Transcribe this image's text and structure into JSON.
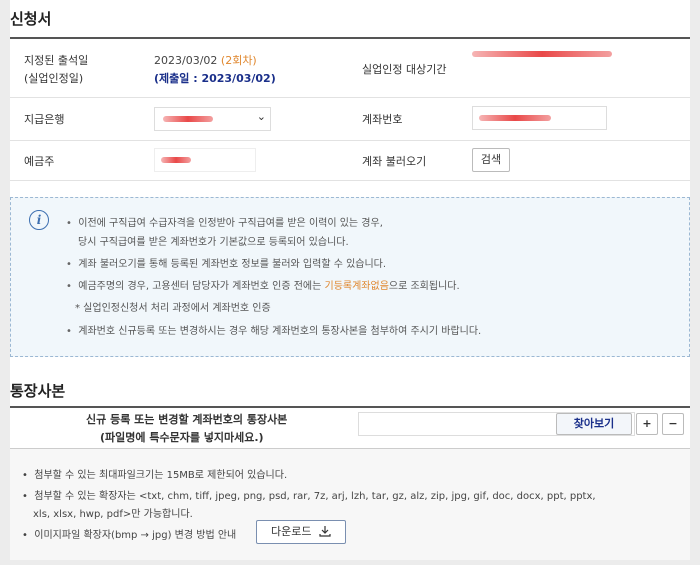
{
  "application": {
    "title": "신청서",
    "rows": {
      "attendance_label_1": "지정된 출석일",
      "attendance_label_2": "(실업인정일)",
      "attendance_date": "2023/03/02",
      "attendance_round": "(2회차)",
      "submit_date": "(제출일 : 2023/03/02)",
      "period_label": "실업인정 대상기간",
      "bank_label": "지급은행",
      "account_label": "계좌번호",
      "holder_label": "예금주",
      "load_account_label": "계좌 불러오기",
      "search_button": "검색"
    }
  },
  "info": {
    "icon": "info-icon",
    "line1": "이전에 구직급여 수급자격을 인정받아 구직급여를 받은 이력이 있는 경우,",
    "line1b": "당시 구직급여를 받은 계좌번호가 기본값으로 등록되어 있습니다.",
    "line2": "계좌 불러오기를 통해 등록된 계좌번호 정보를 불러와 입력할 수 있습니다.",
    "line3a": "예금주명의 경우, 고용센터 담당자가 계좌번호 인증 전에는 ",
    "line3_highlight": "기등록계좌없음",
    "line3b": "으로 조회됩니다.",
    "line3_sub": "* 실업인정신청서 처리 과정에서 계좌번호 인증",
    "line4": "계좌번호 신규등록 또는 변경하시는 경우 해당 계좌번호의 통장사본을 첨부하여 주시기 바랍니다."
  },
  "bankbook": {
    "title": "통장사본",
    "upload_label_1": "신규 등록 또는 변경할 계좌번호의 통장사본",
    "upload_label_2": "(파일명에 특수문자를 넣지마세요.)",
    "browse_button": "찾아보기",
    "add_button": "+",
    "remove_button": "−",
    "note1": "첨부할 수 있는 최대파일크기는 15MB로 제한되어 있습니다.",
    "note2": "첨부할 수 있는 확장자는 <txt, chm, tiff, jpeg, png, psd, rar, 7z, arj, lzh, tar, gz, alz, zip, jpg, gif, doc, docx, ppt, pptx,",
    "note2b": "xls, xlsx, hwp, pdf>만 가능합니다.",
    "note3": "이미지파일 확장자(bmp → jpg) 변경 방법 안내",
    "download_button": "다운로드"
  },
  "colors": {
    "accent_orange": "#e0872e",
    "accent_navy": "#1a2f8a",
    "info_bg": "#f1f7fb"
  }
}
